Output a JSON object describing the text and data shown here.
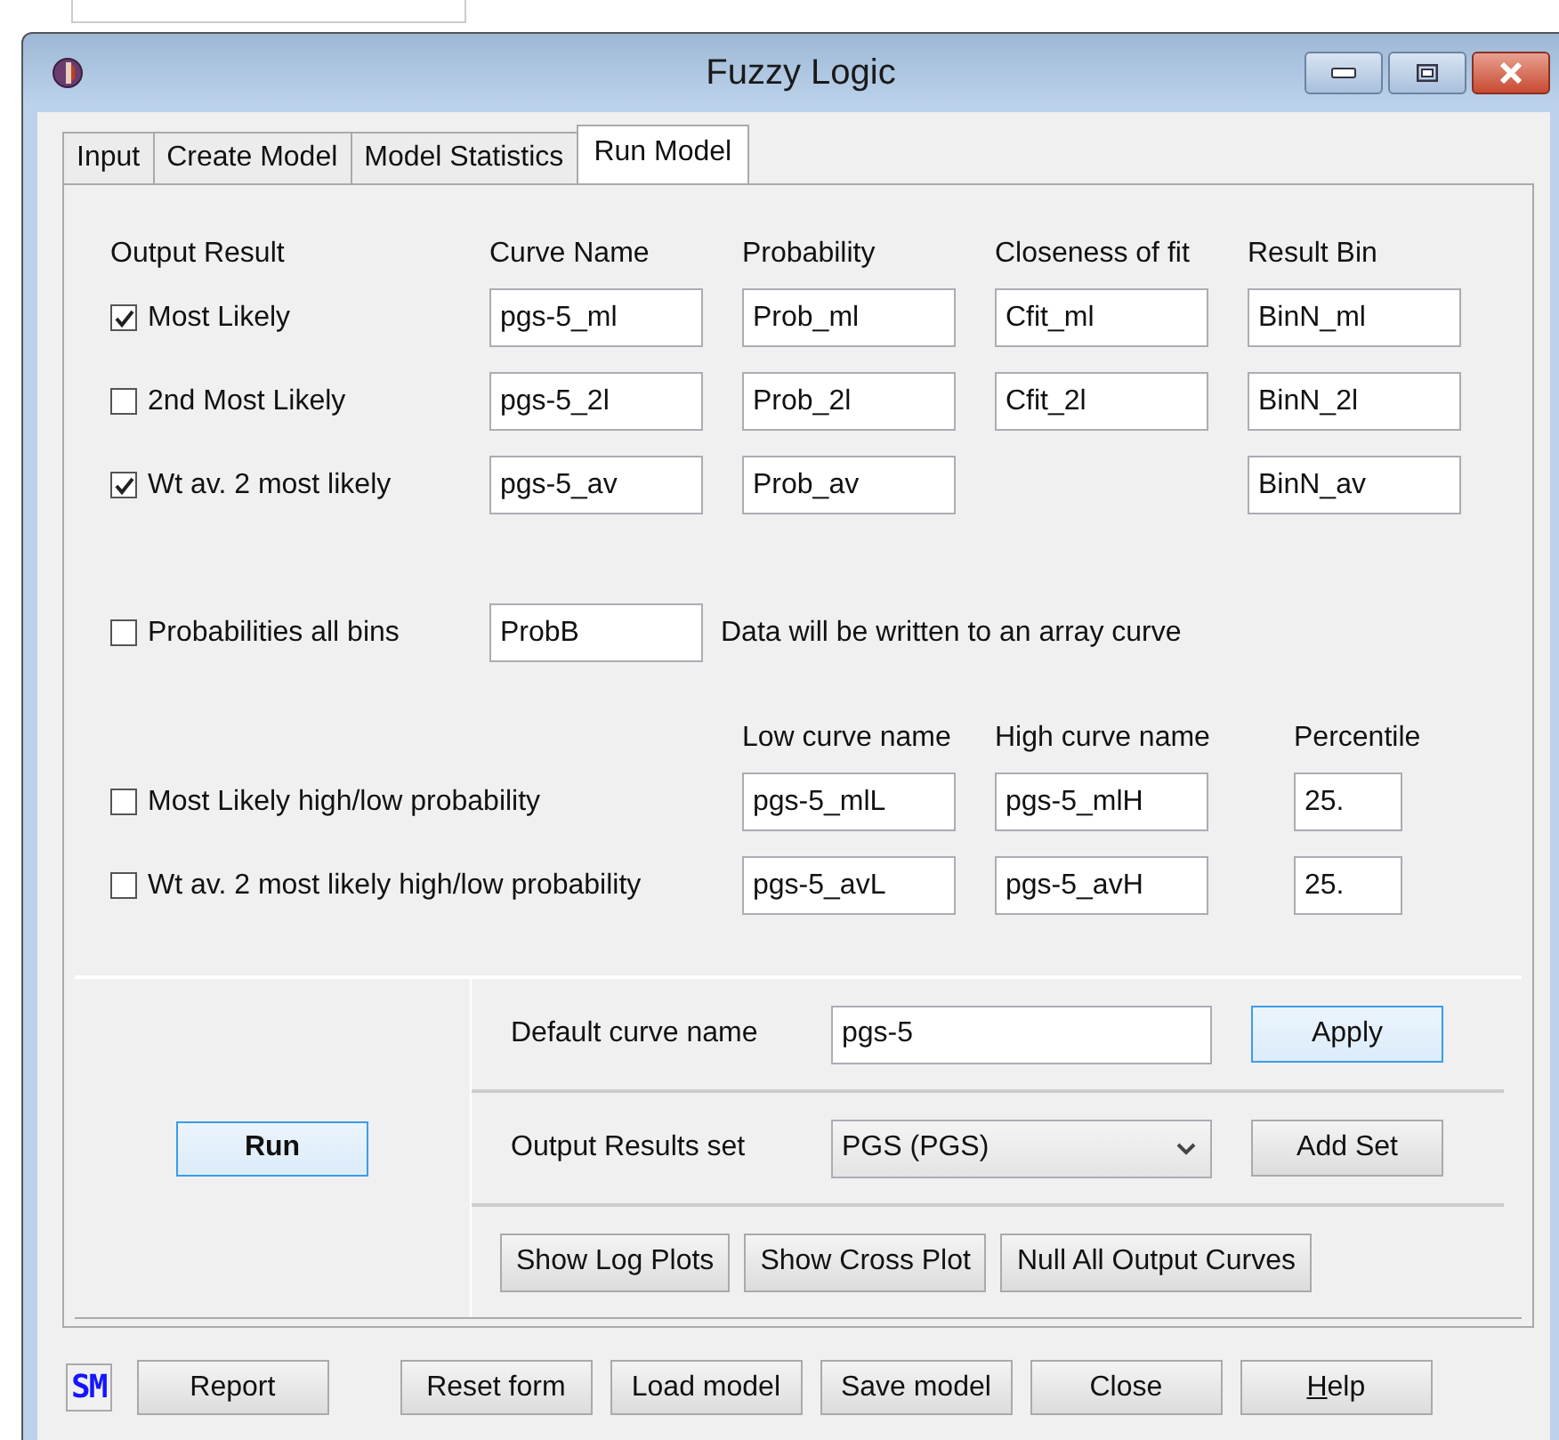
{
  "window": {
    "title": "Fuzzy Logic"
  },
  "tabs": [
    {
      "label": "Input",
      "selected": false
    },
    {
      "label": "Create Model",
      "selected": false
    },
    {
      "label": "Model Statistics",
      "selected": false
    },
    {
      "label": "Run Model",
      "selected": true
    }
  ],
  "outputs": {
    "headers": [
      "Output Result",
      "Curve Name",
      "Probability",
      "Closeness of fit",
      "Result Bin"
    ],
    "rows": [
      {
        "label": "Most Likely",
        "checked": true,
        "curve": "pgs-5_ml",
        "probability": "Prob_ml",
        "closeness": "Cfit_ml",
        "bin": "BinN_ml"
      },
      {
        "label": "2nd Most Likely",
        "checked": false,
        "curve": "pgs-5_2l",
        "probability": "Prob_2l",
        "closeness": "Cfit_2l",
        "bin": "BinN_2l"
      },
      {
        "label": "Wt av. 2 most likely",
        "checked": true,
        "curve": "pgs-5_av",
        "probability": "Prob_av",
        "bin": "BinN_av"
      }
    ]
  },
  "all_bins": {
    "label": "Probabilities all bins",
    "checked": false,
    "value": "ProbB",
    "note": "Data will be written to an array curve"
  },
  "high_low": {
    "headers": [
      "Low curve name",
      "High curve name",
      "Percentile"
    ],
    "rows": [
      {
        "label": "Most Likely high/low probability",
        "checked": false,
        "low": "pgs-5_mlL",
        "high": "pgs-5_mlH",
        "percentile": "25."
      },
      {
        "label": "Wt av. 2 most likely high/low probability",
        "checked": false,
        "low": "pgs-5_avL",
        "high": "pgs-5_avH",
        "percentile": "25."
      }
    ]
  },
  "run_button": {
    "label": "Run",
    "focused": true
  },
  "default_curve": {
    "label": "Default curve name",
    "value": "pgs-5"
  },
  "apply_button": {
    "label": "Apply",
    "focused": true
  },
  "result_set": {
    "label": "Output Results set",
    "value": "PGS (PGS)"
  },
  "add_set_button": {
    "label": "Add Set",
    "focused": false
  },
  "action_buttons": [
    {
      "label": "Show Log Plots",
      "focused": false
    },
    {
      "label": "Show Cross Plot",
      "focused": false
    },
    {
      "label": "Null All Output Curves",
      "focused": false
    }
  ],
  "footer": {
    "logo": "SM",
    "buttons": [
      {
        "label": "Report",
        "underline_first": false
      },
      {
        "label": "Reset form",
        "underline_first": false
      },
      {
        "label": "Load model",
        "underline_first": false
      },
      {
        "label": "Save model",
        "underline_first": false
      },
      {
        "label": "Close",
        "underline_first": false
      },
      {
        "label": "Help",
        "underline_first": true
      }
    ]
  }
}
